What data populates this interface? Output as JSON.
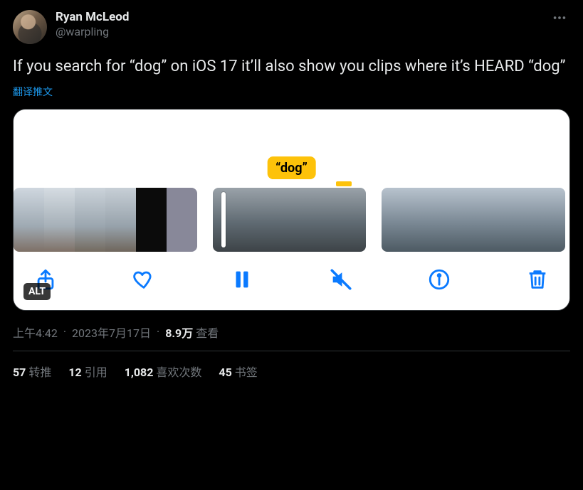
{
  "user": {
    "display_name": "Ryan McLeod",
    "handle": "@warpling"
  },
  "tweet": {
    "text": "If you search for “dog” on iOS 17 it’ll also show you clips where it’s HEARD “dog”",
    "translate_label": "翻译推文"
  },
  "media": {
    "highlight_label": "“dog”",
    "alt_badge": "ALT"
  },
  "meta": {
    "time": "上午4:42",
    "date": "2023年7月17日",
    "views_count": "8.9万",
    "views_label": "查看"
  },
  "stats": {
    "retweets": {
      "count": "57",
      "label": "转推"
    },
    "quotes": {
      "count": "12",
      "label": "引用"
    },
    "likes": {
      "count": "1,082",
      "label": "喜欢次数"
    },
    "bookmarks": {
      "count": "45",
      "label": "书签"
    }
  }
}
